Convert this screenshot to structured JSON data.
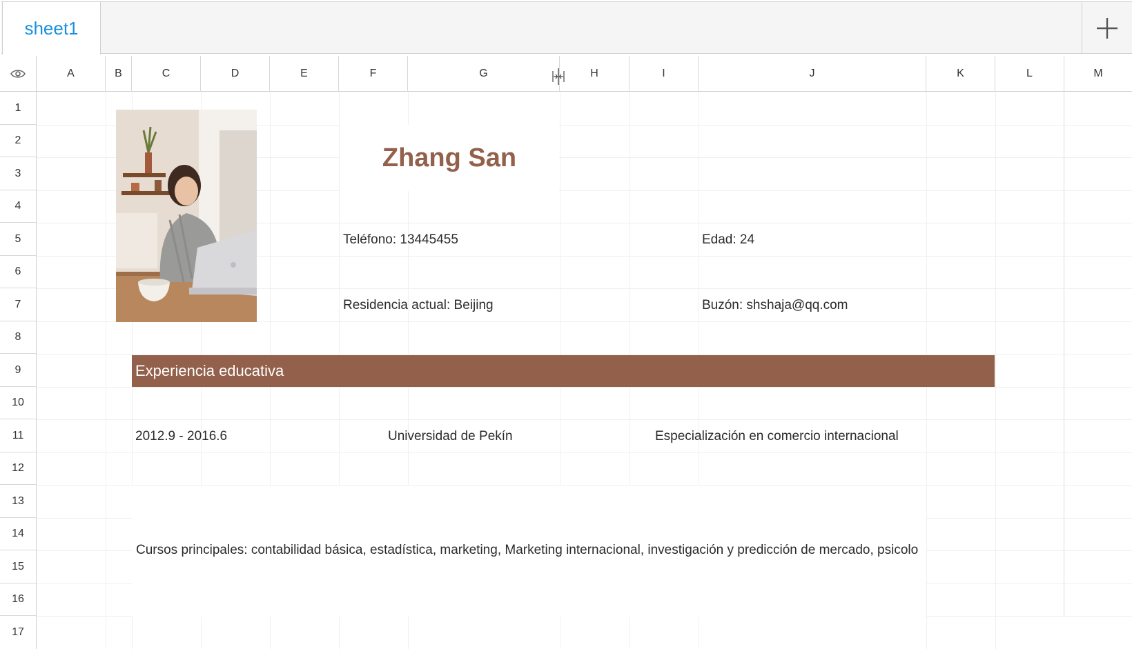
{
  "tabs": [
    {
      "label": "sheet1",
      "active": true
    }
  ],
  "columns": [
    "A",
    "B",
    "C",
    "D",
    "E",
    "F",
    "G",
    "H",
    "I",
    "J",
    "K",
    "L",
    "M"
  ],
  "rows": [
    "1",
    "2",
    "3",
    "4",
    "5",
    "6",
    "7",
    "8",
    "9",
    "10",
    "11",
    "12",
    "13",
    "14",
    "15",
    "16",
    "17"
  ],
  "icons": {
    "visibility": "eye-icon",
    "add_sheet": "plus-icon",
    "column_resize": "column-resize-icon"
  },
  "resume": {
    "name": "Zhang San",
    "phone": "Teléfono: 13445455",
    "age": "Edad: 24",
    "residence": "Residencia actual: Beijing",
    "mailbox": "Buzón: shshaja@qq.com",
    "section_title": "Experiencia educativa",
    "edu_period": "2012.9 - 2016.6",
    "university": "Universidad de Pekín",
    "major": "Especialización en comercio internacional",
    "courses": "Cursos principales: contabilidad básica, estadística, marketing, Marketing internacional, investigación y predicción de mercado, psicolo"
  },
  "colors": {
    "accent": "#93604b",
    "tab_active": "#1a8fe0",
    "header_bg": "#f5f5f5"
  }
}
